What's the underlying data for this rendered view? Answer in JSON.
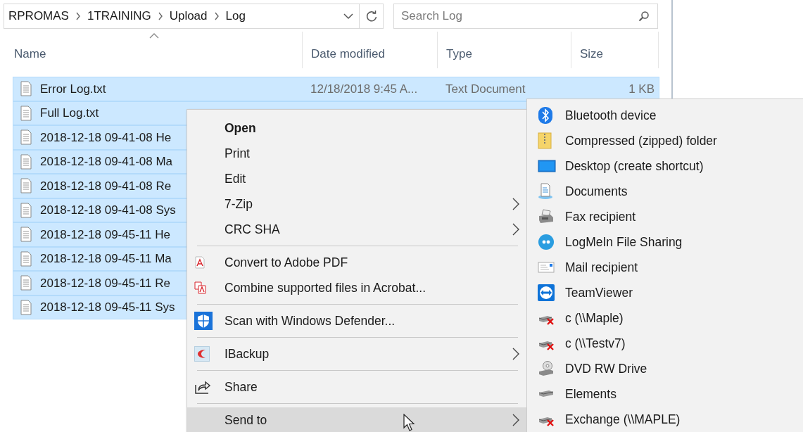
{
  "address_bar": {
    "crumbs": [
      "RPROMAS",
      "1TRAINING",
      "Upload",
      "Log"
    ]
  },
  "search": {
    "placeholder": "Search Log"
  },
  "columns": [
    {
      "label": "Name",
      "sorted": true
    },
    {
      "label": "Date modified",
      "sorted": false
    },
    {
      "label": "Type",
      "sorted": false
    },
    {
      "label": "Size",
      "sorted": false
    }
  ],
  "files": [
    {
      "name": "Error Log.txt",
      "date": "12/18/2018 9:45 A...",
      "type": "Text Document",
      "size": "1 KB",
      "selected": true
    },
    {
      "name": "Full Log.txt",
      "selected": true
    },
    {
      "name": "2018-12-18 09-41-08 He",
      "selected": true
    },
    {
      "name": "2018-12-18 09-41-08 Ma",
      "selected": true
    },
    {
      "name": "2018-12-18 09-41-08 Re",
      "selected": true
    },
    {
      "name": "2018-12-18 09-41-08 Sys",
      "selected": true
    },
    {
      "name": "2018-12-18 09-45-11 He",
      "selected": true
    },
    {
      "name": "2018-12-18 09-45-11 Ma",
      "selected": true
    },
    {
      "name": "2018-12-18 09-45-11 Re",
      "selected": true
    },
    {
      "name": "2018-12-18 09-45-11 Sys",
      "selected": true
    }
  ],
  "context_menu": {
    "items": [
      {
        "kind": "item",
        "label": "Open",
        "default": true,
        "has_submenu": false,
        "selected": false
      },
      {
        "kind": "item",
        "label": "Print",
        "default": false,
        "has_submenu": false,
        "selected": false
      },
      {
        "kind": "item",
        "label": "Edit",
        "default": false,
        "has_submenu": false,
        "selected": false
      },
      {
        "kind": "item",
        "label": "7-Zip",
        "default": false,
        "has_submenu": true,
        "selected": false
      },
      {
        "kind": "item",
        "label": "CRC SHA",
        "default": false,
        "has_submenu": true,
        "selected": false
      },
      {
        "kind": "separator"
      },
      {
        "kind": "item",
        "label": "Convert to Adobe PDF",
        "default": false,
        "has_submenu": false,
        "selected": false
      },
      {
        "kind": "item",
        "label": "Combine supported files in Acrobat...",
        "default": false,
        "has_submenu": false,
        "selected": false
      },
      {
        "kind": "separator"
      },
      {
        "kind": "item",
        "label": "Scan with Windows Defender...",
        "default": false,
        "has_submenu": false,
        "selected": false
      },
      {
        "kind": "separator"
      },
      {
        "kind": "item",
        "label": "IBackup",
        "default": false,
        "has_submenu": true,
        "selected": false
      },
      {
        "kind": "separator"
      },
      {
        "kind": "item",
        "label": "Share",
        "default": false,
        "has_submenu": false,
        "selected": false
      },
      {
        "kind": "separator"
      },
      {
        "kind": "item",
        "label": "Send to",
        "default": false,
        "has_submenu": true,
        "selected": true
      }
    ]
  },
  "send_to_menu": {
    "items": [
      {
        "label": "Bluetooth device"
      },
      {
        "label": "Compressed (zipped) folder"
      },
      {
        "label": "Desktop (create shortcut)"
      },
      {
        "label": "Documents"
      },
      {
        "label": "Fax recipient"
      },
      {
        "label": "LogMeIn File Sharing"
      },
      {
        "label": "Mail recipient"
      },
      {
        "label": "TeamViewer"
      },
      {
        "label": "c (\\\\Maple)"
      },
      {
        "label": "c (\\\\Testv7)"
      },
      {
        "label": "DVD RW Drive"
      },
      {
        "label": "Elements"
      },
      {
        "label": "Exchange (\\\\MAPLE)"
      }
    ]
  }
}
